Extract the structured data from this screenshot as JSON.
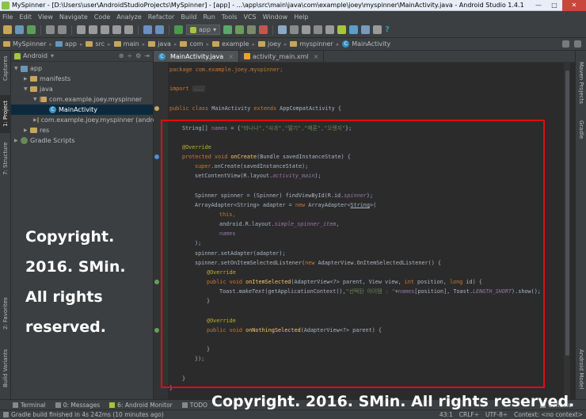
{
  "window": {
    "title": "MySpinner - [D:\\Users\\user\\AndroidStudioProjects\\MySpinner] - [app] - ...\\app\\src\\main\\java\\com\\example\\joey\\myspinner\\MainActivity.java - Android Studio 1.4.1",
    "minimize": "—",
    "maximize": "□",
    "close": "✕"
  },
  "menu": [
    "File",
    "Edit",
    "View",
    "Navigate",
    "Code",
    "Analyze",
    "Refactor",
    "Build",
    "Run",
    "Tools",
    "VCS",
    "Window",
    "Help"
  ],
  "toolbar": {
    "run_config": "app",
    "run_config_arrow": "▾",
    "help": "?"
  },
  "breadcrumbs": [
    "MySpinner",
    "app",
    "src",
    "main",
    "java",
    "com",
    "example",
    "joey",
    "myspinner",
    "MainActivity"
  ],
  "project": {
    "view_mode": "Android",
    "tree": [
      {
        "label": "app",
        "depth": 0,
        "arrow": "▼",
        "icon": "module"
      },
      {
        "label": "manifests",
        "depth": 1,
        "arrow": "▶",
        "icon": "folder"
      },
      {
        "label": "java",
        "depth": 1,
        "arrow": "▼",
        "icon": "folder"
      },
      {
        "label": "com.example.joey.myspinner",
        "depth": 2,
        "arrow": "▼",
        "icon": "package"
      },
      {
        "label": "MainActivity",
        "depth": 3,
        "arrow": "",
        "icon": "class",
        "selected": true
      },
      {
        "label": "com.example.joey.myspinner (andro",
        "depth": 2,
        "arrow": "▶",
        "icon": "package"
      },
      {
        "label": "res",
        "depth": 1,
        "arrow": "▶",
        "icon": "folder"
      },
      {
        "label": "Gradle Scripts",
        "depth": 0,
        "arrow": "▶",
        "icon": "gradle"
      }
    ]
  },
  "side_tabs": {
    "left": [
      "Captures",
      "1: Project",
      "7: Structure",
      "2: Favorites",
      "Build Variants"
    ],
    "right": [
      "Maven Projects",
      "Gradle",
      "Android Model"
    ]
  },
  "editor_tabs": [
    {
      "label": "MainActivity.java",
      "active": true
    },
    {
      "label": "activity_main.xml",
      "active": false
    }
  ],
  "code": {
    "package_line": "package com.example.joey.myspinner;",
    "import_kw": "import",
    "import_fold": "...",
    "class_line": {
      "kw1": "public",
      "kw2": "class",
      "name": "MainActivity",
      "kw3": "extends",
      "parent": "AppCompatActivity",
      "brace": "{"
    },
    "names_decl": "String[] ",
    "names_var": "names",
    "names_eq": " = {",
    "names_items": "\"바나나\",\"사과\",\"딸기\",\"메론\",\"오렌지\"",
    "names_end": "};",
    "override1": "@Override",
    "oncreate": {
      "kw": "protected void ",
      "name": "onCreate",
      "params": "(Bundle savedInstanceState) {"
    },
    "super_line": "super",
    "super_rest": ".onCreate(savedInstanceState);",
    "setcontent": "setContentView(R.layout.",
    "setcontent_res": "activity_main",
    "setcontent_end": ");",
    "spinner_line": "Spinner spinner = (Spinner) findViewById(R.id.",
    "spinner_res": "spinner",
    "spinner_end": ");",
    "adapter_line": "ArrayAdapter<String> adapter = ",
    "adapter_new": "new ",
    "adapter_type": "ArrayAdapter<",
    "adapter_generic": "String",
    "adapter_close": ">(",
    "this_kw": "this,",
    "layout_line": "android.R.layout.",
    "layout_res": "simple_spinner_item",
    "layout_end": ",",
    "names_ref": "names",
    "close_paren": ");",
    "setadapter": "spinner.setAdapter(adapter);",
    "listener_line": "spinner.setOnItemSelectedListener(",
    "listener_new": "new ",
    "listener_rest": "AdapterView.OnItemSelectedListener() {",
    "override2": "@Override",
    "onitem": {
      "kw": "public void ",
      "name": "onItemSelected",
      "params": "(AdapterView<?> parent, View view, ",
      "int": "int ",
      "pos": "position, ",
      "long": "long ",
      "id": "id) {"
    },
    "toast_a": "Toast.",
    "toast_make": "makeText",
    "toast_b": "(getApplicationContext(),",
    "toast_str": "\"선택된 아이템 : \"",
    "toast_c": "+",
    "toast_names": "names",
    "toast_d": "[position], Toast.",
    "toast_len": "LENGTH_SHORT",
    "toast_e": ").show();",
    "brace_close": "}",
    "override3": "@Override",
    "onnothing": {
      "kw": "public void ",
      "name": "onNothingSelected",
      "params": "(AdapterView<?> parent) {"
    },
    "close_listener": "});",
    "class_close": "}"
  },
  "watermark": {
    "lines": [
      "Copyright.",
      "2016. SMin.",
      "All rights",
      "reserved."
    ],
    "bottom": "Copyright. 2016. SMin. All rights reserved."
  },
  "bottom_tools": [
    "Terminal",
    "0: Messages",
    "6: Android Monitor",
    "TODO",
    "Console"
  ],
  "status": {
    "message": "Gradle build finished in 4s 242ms (10 minutes ago)",
    "position": "43:1",
    "line_sep": "CRLF÷",
    "encoding": "UTF-8÷",
    "context": "Context: <no context>"
  },
  "colors": {
    "highlight_box": "#e30c0c",
    "keyword": "#cc7832",
    "string": "#6a8759",
    "annotation": "#bbb529",
    "method": "#ffc66d",
    "field": "#9876aa"
  }
}
